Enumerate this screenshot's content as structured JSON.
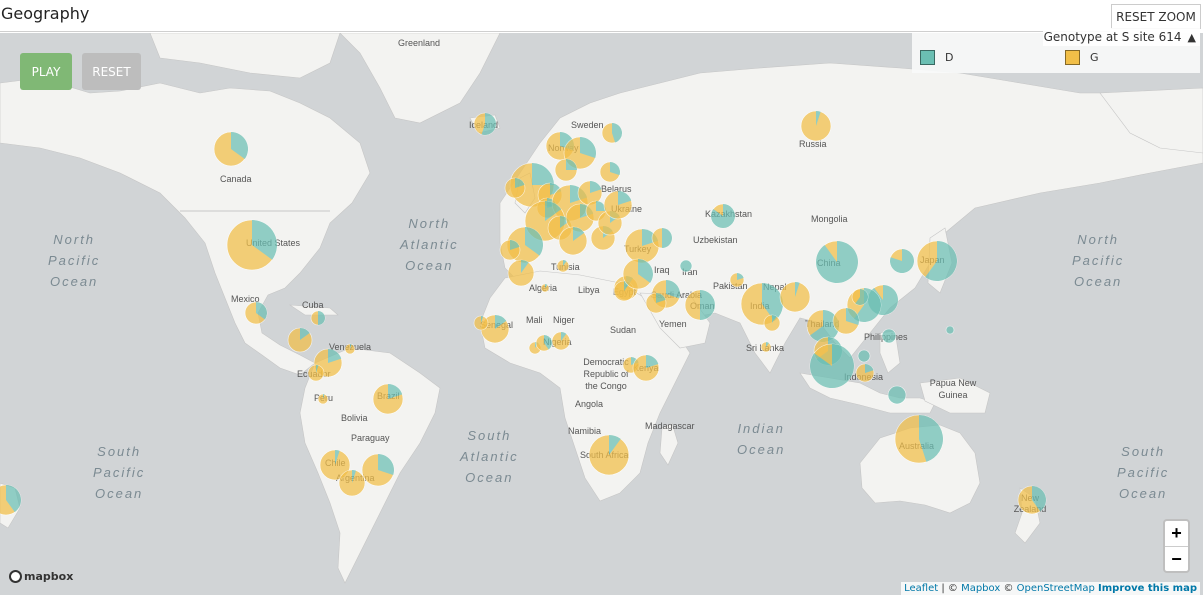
{
  "header": {
    "title": "Geography",
    "reset_zoom_label": "RESET ZOOM"
  },
  "controls": {
    "play_label": "PLAY",
    "reset_label": "RESET"
  },
  "legend": {
    "title": "Genotype at S site 614",
    "items": [
      {
        "label": "D",
        "color": "#6bbfb3"
      },
      {
        "label": "G",
        "color": "#f2bf48"
      }
    ]
  },
  "zoom": {
    "in_label": "+",
    "out_label": "−"
  },
  "attribution": {
    "leaflet": "Leaflet",
    "sep1": " | © ",
    "mapbox": "Mapbox",
    "sep2": " © ",
    "osm": "OpenStreetMap",
    "improve": "Improve this map"
  },
  "mapbox_logo": "mapbox",
  "oceans": [
    {
      "lines": [
        "North",
        "Pacific",
        "Ocean"
      ]
    },
    {
      "lines": [
        "North",
        "Atlantic",
        "Ocean"
      ]
    },
    {
      "lines": [
        "North",
        "Pacific",
        "Ocean"
      ]
    },
    {
      "lines": [
        "South",
        "Pacific",
        "Ocean"
      ]
    },
    {
      "lines": [
        "South",
        "Atlantic",
        "Ocean"
      ]
    },
    {
      "lines": [
        "Indian",
        "Ocean"
      ]
    },
    {
      "lines": [
        "South",
        "Pacific",
        "Ocean"
      ]
    }
  ],
  "place_labels": [
    "Greenland",
    "Iceland",
    "Sweden",
    "Norway",
    "Canada",
    "United States",
    "Russia",
    "Kazakhstan",
    "Mongolia",
    "China",
    "Japan",
    "Uzbekistan",
    "Belarus",
    "Ukraine",
    "Turkey",
    "Iraq",
    "Iran",
    "Pakistan",
    "Nepal",
    "India",
    "Saudi Arabia",
    "Egypt",
    "Libya",
    "Algeria",
    "Tunisia",
    "Mali",
    "Niger",
    "Sudan",
    "Yemen",
    "Oman",
    "Senegal",
    "Nigeria",
    "Democratic Republic of the Congo",
    "Kenya",
    "Angola",
    "Namibia",
    "South Africa",
    "Madagascar",
    "Sri Lanka",
    "Thailand",
    "Philippines",
    "Indonesia",
    "Papua New Guinea",
    "Australia",
    "New Zealand",
    "Mexico",
    "Cuba",
    "Venezuela",
    "Ecuador",
    "Peru",
    "Brazil",
    "Bolivia",
    "Paraguay",
    "Chile",
    "Argentina"
  ],
  "pies": [
    {
      "name": "canada",
      "d": 0.35
    },
    {
      "name": "usa",
      "d": 0.35
    },
    {
      "name": "mexico",
      "d": 0.35
    },
    {
      "name": "cuba",
      "d": 0.5
    },
    {
      "name": "central-america",
      "d": 0.15
    },
    {
      "name": "venezuela",
      "d": 0.05
    },
    {
      "name": "colombia",
      "d": 0.2
    },
    {
      "name": "ecuador",
      "d": 0.05
    },
    {
      "name": "peru",
      "d": 0.05
    },
    {
      "name": "brazil",
      "d": 0.2
    },
    {
      "name": "chile",
      "d": 0.05
    },
    {
      "name": "argentina",
      "d": 0.05
    },
    {
      "name": "uruguay",
      "d": 0.3
    },
    {
      "name": "iceland",
      "d": 0.55
    },
    {
      "name": "norway",
      "d": 0.3
    },
    {
      "name": "sweden",
      "d": 0.3
    },
    {
      "name": "finland",
      "d": 0.45
    },
    {
      "name": "denmark",
      "d": 0.25
    },
    {
      "name": "uk",
      "d": 0.25
    },
    {
      "name": "ireland",
      "d": 0.2
    },
    {
      "name": "netherlands",
      "d": 0.2
    },
    {
      "name": "belgium",
      "d": 0.2
    },
    {
      "name": "germany",
      "d": 0.2
    },
    {
      "name": "poland",
      "d": 0.2
    },
    {
      "name": "france",
      "d": 0.15
    },
    {
      "name": "switzerland",
      "d": 0.15
    },
    {
      "name": "austria",
      "d": 0.2
    },
    {
      "name": "czech",
      "d": 0.25
    },
    {
      "name": "spain",
      "d": 0.35
    },
    {
      "name": "portugal",
      "d": 0.2
    },
    {
      "name": "italy",
      "d": 0.15
    },
    {
      "name": "greece",
      "d": 0.15
    },
    {
      "name": "balkans",
      "d": 0.15
    },
    {
      "name": "belarus",
      "d": 0.3
    },
    {
      "name": "ukraine",
      "d": 0.2
    },
    {
      "name": "russia",
      "d": 0.05
    },
    {
      "name": "turkey",
      "d": 0.2
    },
    {
      "name": "georgia",
      "d": 0.5
    },
    {
      "name": "kazakhstan",
      "d": 0.85
    },
    {
      "name": "israel",
      "d": 0.1
    },
    {
      "name": "egypt",
      "d": 0.1
    },
    {
      "name": "iraq",
      "d": 0.35
    },
    {
      "name": "iran",
      "d": 1.0
    },
    {
      "name": "saudi-arabia",
      "d": 0.3
    },
    {
      "name": "kuwait",
      "d": 0.2
    },
    {
      "name": "oman",
      "d": 0.5
    },
    {
      "name": "pakistan",
      "d": 0.2
    },
    {
      "name": "india",
      "d": 0.4
    },
    {
      "name": "nepal",
      "d": 0.05
    },
    {
      "name": "bangladesh",
      "d": 0.1
    },
    {
      "name": "sri-lanka",
      "d": 0.1
    },
    {
      "name": "china",
      "d": 0.9
    },
    {
      "name": "korea",
      "d": 0.8
    },
    {
      "name": "japan",
      "d": 0.6
    },
    {
      "name": "taiwan",
      "d": 0.9
    },
    {
      "name": "thailand",
      "d": 0.65
    },
    {
      "name": "vietnam",
      "d": 0.6
    },
    {
      "name": "cambodia",
      "d": 0.3
    },
    {
      "name": "hong-kong",
      "d": 0.6
    },
    {
      "name": "philippines",
      "d": 1.0
    },
    {
      "name": "malaysia",
      "d": 0.65
    },
    {
      "name": "singapore",
      "d": 0.85
    },
    {
      "name": "indonesia",
      "d": 0.2
    },
    {
      "name": "brunei",
      "d": 1.0
    },
    {
      "name": "guam",
      "d": 1.0
    },
    {
      "name": "png",
      "d": 1.0
    },
    {
      "name": "australia",
      "d": 0.45
    },
    {
      "name": "new-zealand",
      "d": 0.4
    },
    {
      "name": "new-zealand-west",
      "d": 0.4
    },
    {
      "name": "senegal",
      "d": 0.15
    },
    {
      "name": "gambia",
      "d": 0.05
    },
    {
      "name": "ghana",
      "d": 0.1
    },
    {
      "name": "nigeria",
      "d": 0.1
    },
    {
      "name": "benin",
      "d": 0.4
    },
    {
      "name": "tunisia",
      "d": 0.1
    },
    {
      "name": "algeria",
      "d": 0.1
    },
    {
      "name": "morocco",
      "d": 0.1
    },
    {
      "name": "drc",
      "d": 0.2
    },
    {
      "name": "kenya",
      "d": 0.2
    },
    {
      "name": "south-africa",
      "d": 0.1
    }
  ]
}
